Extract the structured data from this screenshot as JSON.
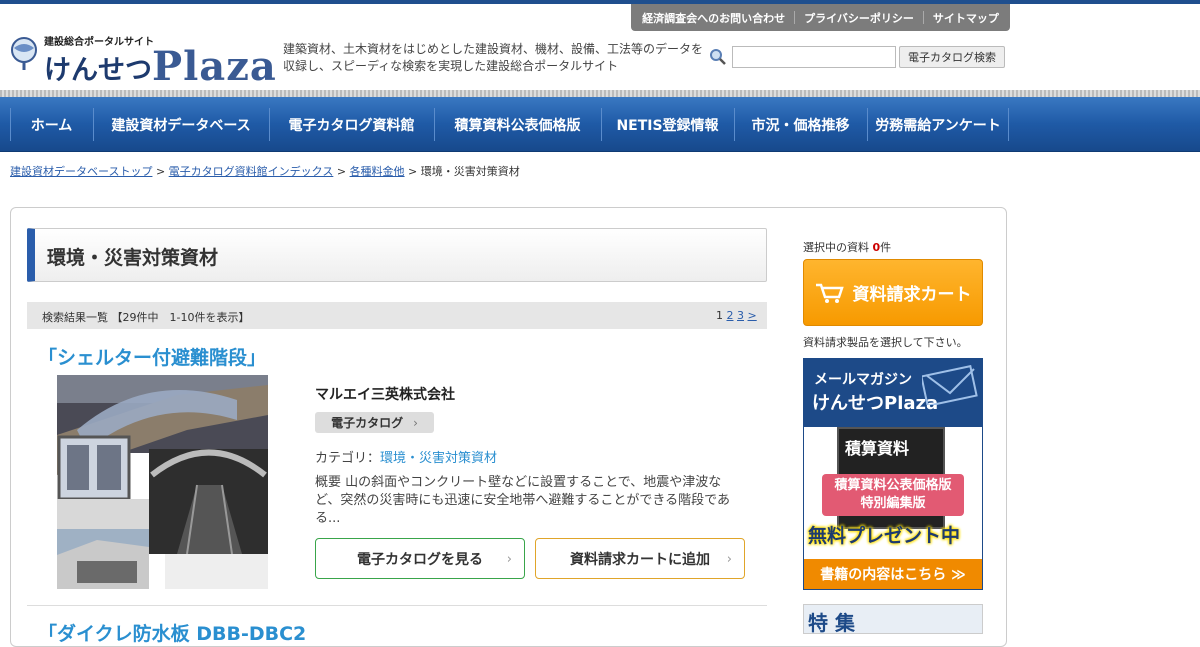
{
  "colors": {
    "brand_blue": "#1f5aa6",
    "link_blue": "#2a8fd0",
    "cart_orange": "#f79a00",
    "catalog_green": "#39a54a"
  },
  "top_links": [
    "経済調査会へのお問い合わせ",
    "プライバシーポリシー",
    "サイトマップ"
  ],
  "logo": {
    "sub": "建設総合ポータルサイト",
    "main_jp": "けんせつ",
    "main_en": "Plaza"
  },
  "tagline": "建築資材、土木資材をはじめとした建設資材、機材、設備、工法等のデータを収録し、スピーディな検索を実現した建設総合ポータルサイト",
  "search": {
    "placeholder": "",
    "button": "電子カタログ検索"
  },
  "nav": [
    "ホーム",
    "建設資材データベース",
    "電子カタログ資料館",
    "積算資料公表価格版",
    "NETIS登録情報",
    "市況・価格推移",
    "労務需給アンケート"
  ],
  "breadcrumb": {
    "crumb1": "建設資材データベーストップ",
    "crumb2": "電子カタログ資料館インデックス",
    "crumb3": "各種料金他",
    "current": "環境・災害対策資材",
    "sep": " > "
  },
  "page_title": "環境・災害対策資材",
  "results": {
    "summary": "検索結果一覧 【29件中　1-10件を表示】",
    "page_current": "1",
    "page2": "2",
    "page3": "3",
    "next": ">"
  },
  "item1": {
    "title": "「シェルター付避難階段」",
    "company": "マルエイ三英株式会社",
    "tag": "電子カタログ",
    "category_label": "カテゴリ：",
    "category_value": "環境・災害対策資材",
    "summary": "概要 山の斜面やコンクリート壁などに設置することで、地震や津波など、突然の災害時にも迅速に安全地帯へ避難することができる階段である...",
    "btn_catalog": "電子カタログを見る",
    "btn_cart": "資料請求カートに追加"
  },
  "item2": {
    "title": "「ダイクレ防水板 DBB-DBC2"
  },
  "sidebar": {
    "selected_prefix": "選択中の資料 ",
    "selected_count": "0",
    "selected_suffix": "件",
    "cart_banner": "資料請求カート",
    "cart_note": "資料請求製品を選択して下さい。",
    "mag_line1": "メールマガジン",
    "mag_line2": "けんせつPlaza",
    "mag_book": "積算資料",
    "mag_pink_1": "積算資料公表価格版",
    "mag_pink_2": "特別編集版",
    "mag_free": "無料プレゼント中",
    "mag_bottom": "書籍の内容はこちら ≫",
    "feature": "特 集"
  }
}
